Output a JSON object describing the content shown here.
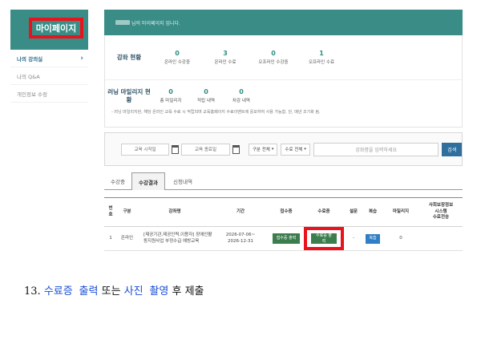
{
  "sidebar": {
    "title": "마이페이지",
    "items": [
      {
        "label": "나의 강의실",
        "active": true
      },
      {
        "label": "나의 Q&A",
        "active": false
      },
      {
        "label": "개인정보 수정",
        "active": false
      }
    ]
  },
  "greeting": {
    "text": "님의 마이페이지 입니다."
  },
  "course_status": {
    "label": "강좌 현황",
    "stats": [
      {
        "num": "0",
        "label": "온라인 수강중"
      },
      {
        "num": "3",
        "label": "온라인 수료"
      },
      {
        "num": "0",
        "label": "오프라인 수강중"
      },
      {
        "num": "1",
        "label": "오프라인 수료"
      }
    ]
  },
  "mileage": {
    "label": "러닝 마일리지 현황",
    "stats": [
      {
        "num": "0",
        "label": "총 마일리지"
      },
      {
        "num": "0",
        "label": "적립 내역"
      },
      {
        "num": "0",
        "label": "차감 내역"
      }
    ],
    "note": "- 러닝 마일리지란, 해당 온라인 교육 수료 시 적립되며 교육홈페이지 수료이벤트에 응모하여 사용 가능함. 단, 매년 조기화 됨."
  },
  "search": {
    "start_date": "교육 시작일",
    "end_date": "교육 종료일",
    "type_select": "구분 전체",
    "status_select": "수료 전체",
    "keyword_placeholder": "강좌명을 입력하세요",
    "button": "검색"
  },
  "tabs": [
    {
      "label": "수강중",
      "active": false
    },
    {
      "label": "수강결과",
      "active": true
    },
    {
      "label": "신청내역",
      "active": false
    }
  ],
  "table": {
    "headers": [
      "번호",
      "구분",
      "강좌명",
      "기간",
      "접수증",
      "수료증",
      "설문",
      "복습",
      "마일리지",
      "사회보장정보시스템 수료전송"
    ],
    "header_lines": {
      "c1": [
        "번",
        "호"
      ],
      "c10": [
        "사회보장정보",
        "시스템",
        "수료전송"
      ]
    },
    "rows": [
      {
        "no": "1",
        "type": "온라인",
        "course_lines": [
          "[제공기관,제공인력,이용자] 장애인활",
          "동지원사업 부정수급 예방교육"
        ],
        "period_lines": [
          "2026-07-06~",
          "2026-12-31"
        ],
        "receipt_btn": "접수증 출력",
        "cert_btn": "수료증 출력",
        "survey": "-",
        "review_btn": "복습",
        "mileage": "0",
        "transfer": ""
      }
    ]
  },
  "caption": {
    "num": "13.",
    "hl1": "수료증 출력",
    "mid": "또는",
    "hl2": "사진 촬영",
    "post": "후 제출"
  },
  "colors": {
    "teal": "#3a8d86",
    "highlight_red": "#e8131c",
    "button_green": "#3c7d4e",
    "button_blue": "#2f7fc6",
    "search_blue": "#2f6f9e",
    "caption_blue": "#1a4fd6"
  }
}
